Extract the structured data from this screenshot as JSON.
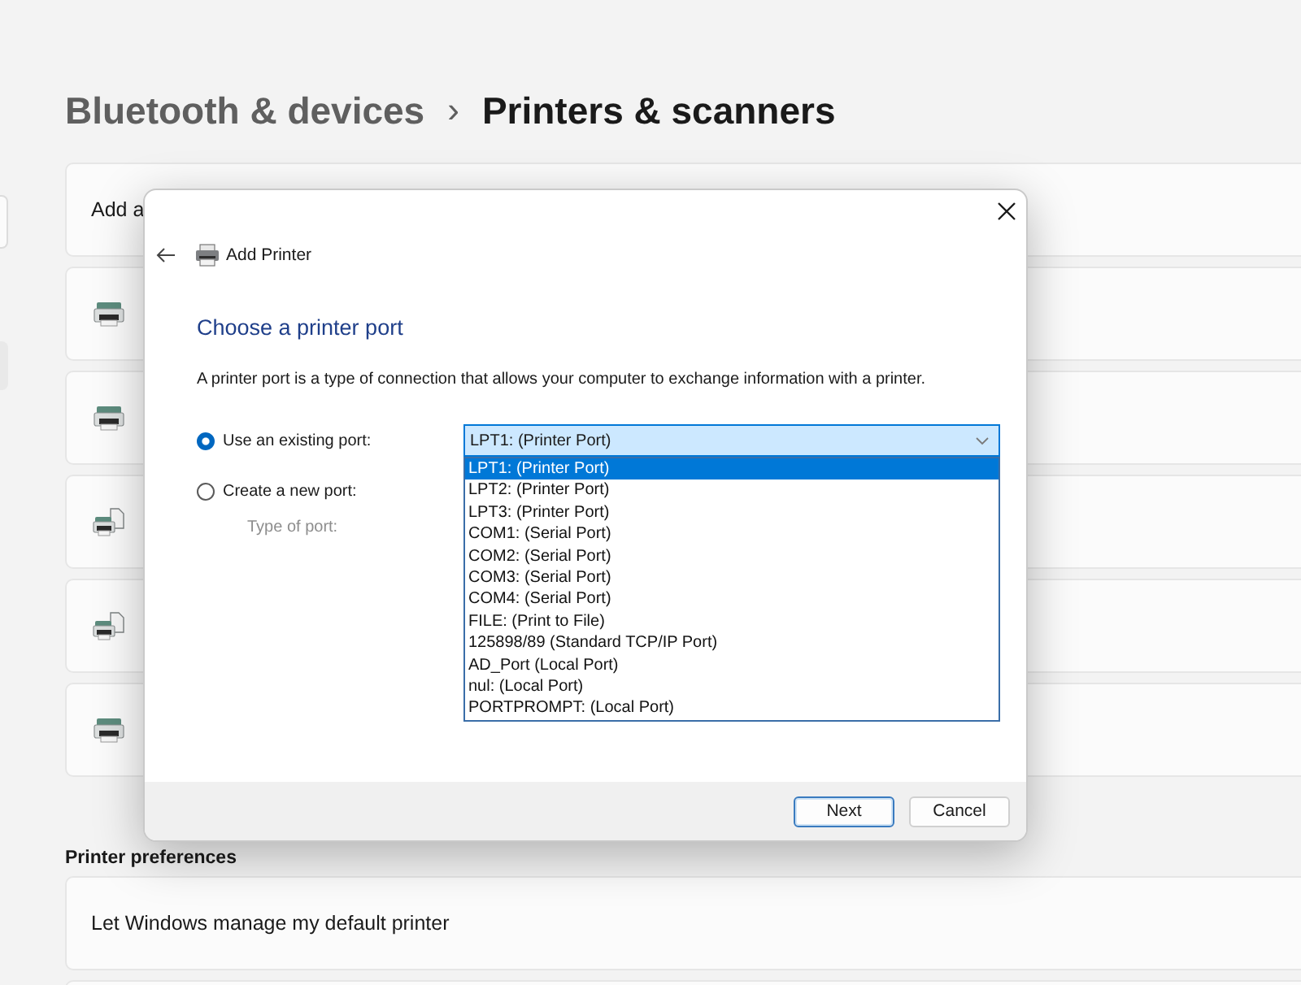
{
  "header": {
    "parent": "Bluetooth & devices",
    "separator": "›",
    "current": "Printers & scanners"
  },
  "cards": [
    {
      "kind": "add",
      "label": "Add a"
    },
    {
      "kind": "printer"
    },
    {
      "kind": "printer"
    },
    {
      "kind": "printer-document"
    },
    {
      "kind": "printer-document"
    },
    {
      "kind": "printer"
    }
  ],
  "preferences": {
    "heading": "Printer preferences",
    "items": [
      {
        "label": "Let Windows manage my default printer"
      }
    ]
  },
  "dialog": {
    "title": "Add Printer",
    "heading": "Choose a printer port",
    "description": "A printer port is a type of connection that allows your computer to exchange information with a printer.",
    "port_choices": [
      {
        "label": "Use an existing port:",
        "selected": true
      },
      {
        "label": "Create a new port:",
        "selected": false
      }
    ],
    "port_type": {
      "label": "Type of port:",
      "disabled": true
    },
    "port_select": {
      "value": "LPT1: (Printer Port)",
      "expanded": true,
      "options": [
        {
          "label": "LPT1: (Printer Port)",
          "selected": true
        },
        {
          "label": "LPT2: (Printer Port)",
          "selected": false
        },
        {
          "label": "LPT3: (Printer Port)",
          "selected": false
        },
        {
          "label": "COM1: (Serial Port)",
          "selected": false
        },
        {
          "label": "COM2: (Serial Port)",
          "selected": false
        },
        {
          "label": "COM3: (Serial Port)",
          "selected": false
        },
        {
          "label": "COM4: (Serial Port)",
          "selected": false
        },
        {
          "label": "FILE: (Print to File)",
          "selected": false
        },
        {
          "label": "125898/89 (Standard TCP/IP Port)",
          "selected": false
        },
        {
          "label": "AD_Port (Local Port)",
          "selected": false
        },
        {
          "label": "nul: (Local Port)",
          "selected": false
        },
        {
          "label": "PORTPROMPT: (Local Port)",
          "selected": false
        }
      ]
    },
    "buttons": [
      {
        "label": "Next",
        "default": true
      },
      {
        "label": "Cancel",
        "default": false
      }
    ]
  }
}
